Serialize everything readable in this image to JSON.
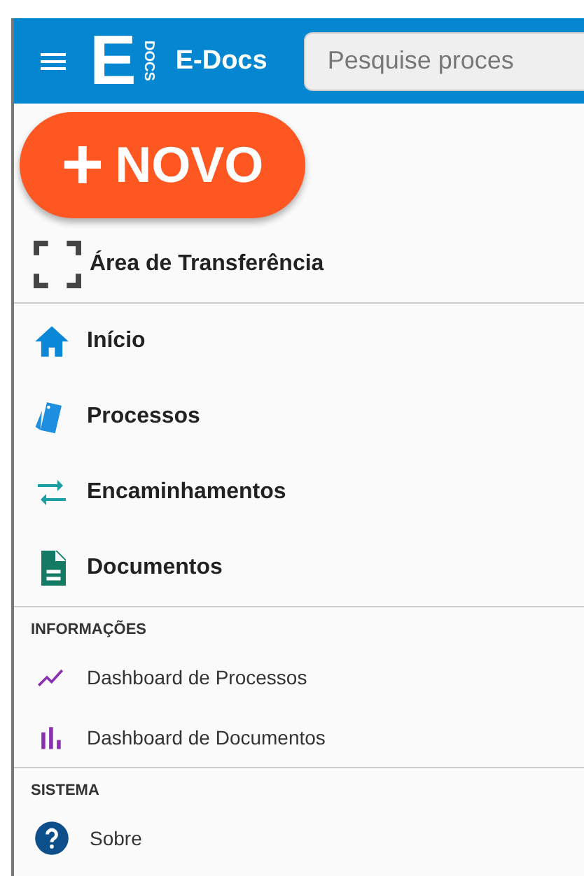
{
  "header": {
    "logo_letter": "E",
    "logo_sub": "DOCS",
    "title": "E-Docs",
    "search": {
      "placeholder": "Pesquise proces"
    }
  },
  "new_button": {
    "icon": "+",
    "label": "NOVO"
  },
  "clipboard": {
    "label": "Área de Transferência"
  },
  "main_items": [
    {
      "label": "Início"
    },
    {
      "label": "Processos"
    },
    {
      "label": "Encaminhamentos"
    },
    {
      "label": "Documentos"
    }
  ],
  "sections": [
    {
      "title": "INFORMAÇÕES",
      "items": [
        {
          "label": "Dashboard de Processos"
        },
        {
          "label": "Dashboard de Documentos"
        }
      ]
    },
    {
      "title": "SISTEMA",
      "items": [
        {
          "label": "Sobre"
        }
      ]
    }
  ]
}
